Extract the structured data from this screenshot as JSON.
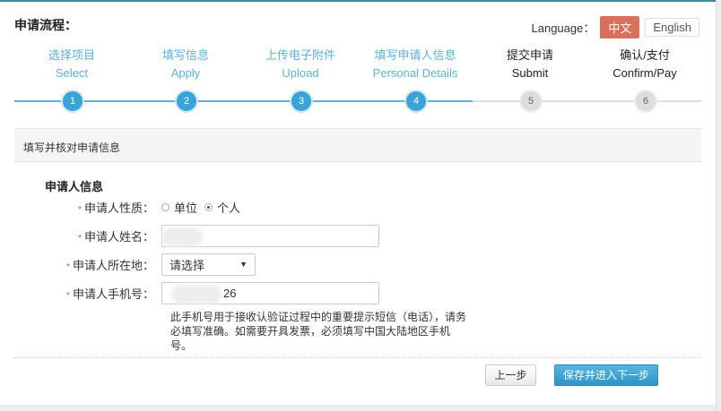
{
  "header": {
    "title": "申请流程：",
    "language_label": "Language：",
    "lang_zh": "中文",
    "lang_en": "English"
  },
  "steps": [
    {
      "cn": "选择项目",
      "en": "Select",
      "num": "1",
      "state": "done"
    },
    {
      "cn": "填写信息",
      "en": "Apply",
      "num": "2",
      "state": "done"
    },
    {
      "cn": "上传电子附件",
      "en": "Upload",
      "num": "3",
      "state": "done"
    },
    {
      "cn": "填写申请人信息",
      "en": "Personal Details",
      "num": "4",
      "state": "done"
    },
    {
      "cn": "提交申请",
      "en": "Submit",
      "num": "5",
      "state": "todo"
    },
    {
      "cn": "确认/支付",
      "en": "Confirm/Pay",
      "num": "6",
      "state": "todo"
    }
  ],
  "section_title": "填写并核对申请信息",
  "form": {
    "subhead": "申请人信息",
    "required_mark": "*",
    "type_label": "申请人性质：",
    "type_opt_org": "单位",
    "type_opt_person": "个人",
    "name_label": "申请人姓名：",
    "name_value": "",
    "location_label": "申请人所在地：",
    "location_value": "请选择",
    "select_arrow": "▼",
    "phone_label": "申请人手机号：",
    "phone_value": "26",
    "hint": "此手机号用于接收认验证过程中的重要提示短信（电话），请务必填写准确。如需要开具发票，必须填写中国大陆地区手机号。"
  },
  "buttons": {
    "prev": "上一步",
    "next": "保存并进入下一步"
  }
}
